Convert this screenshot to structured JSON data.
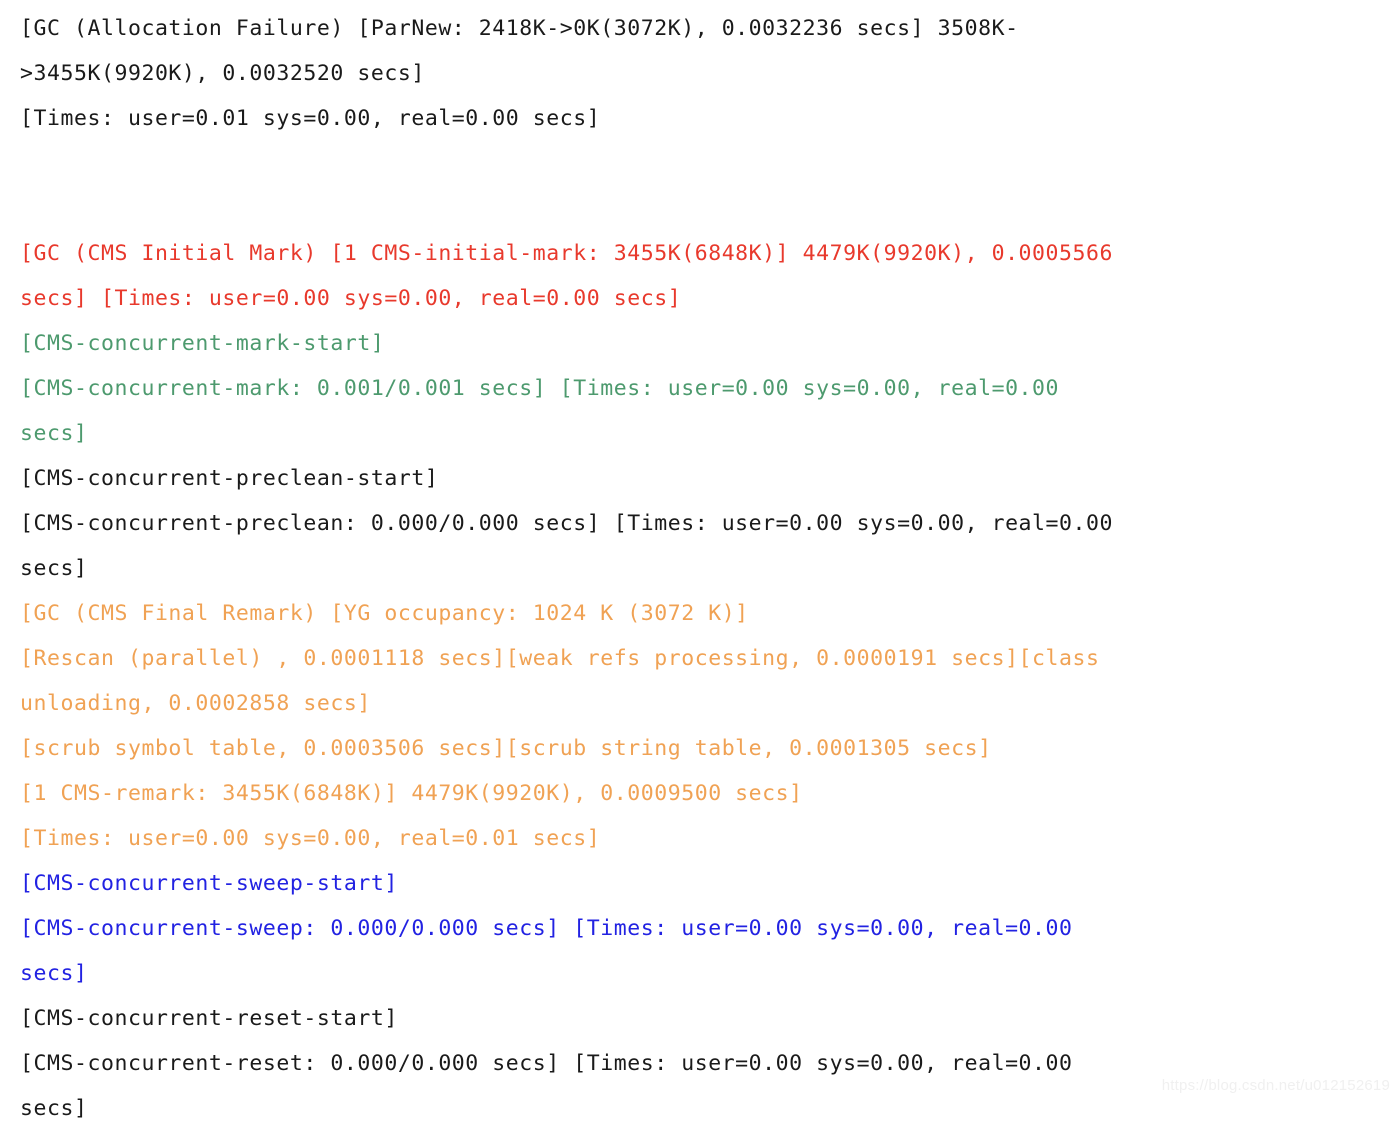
{
  "document": {
    "type": "gc-log-output",
    "background_color": "#ffffff",
    "colors": {
      "black": "#1a1a1a",
      "red": "#e8392c",
      "green": "#4d9a6e",
      "orange": "#f0a254",
      "blue": "#2222e2",
      "watermark": "#f0f0f0"
    },
    "watermark": "https://blog.csdn.net/u012152619",
    "lines": [
      {
        "color": "black",
        "text": "[GC (Allocation Failure) [ParNew: 2418K->0K(3072K), 0.0032236 secs] 3508K-"
      },
      {
        "color": "black",
        "text": ">3455K(9920K), 0.0032520 secs]"
      },
      {
        "color": "black",
        "text": "[Times: user=0.01 sys=0.00, real=0.00 secs]"
      },
      {
        "color": "black",
        "text": ""
      },
      {
        "color": "black",
        "text": ""
      },
      {
        "color": "red",
        "text": "[GC (CMS Initial Mark) [1 CMS-initial-mark: 3455K(6848K)] 4479K(9920K), 0.0005566"
      },
      {
        "color": "red",
        "text": "secs] [Times: user=0.00 sys=0.00, real=0.00 secs]"
      },
      {
        "color": "green",
        "text": "[CMS-concurrent-mark-start]"
      },
      {
        "color": "green",
        "text": "[CMS-concurrent-mark: 0.001/0.001 secs] [Times: user=0.00 sys=0.00, real=0.00"
      },
      {
        "color": "green",
        "text": "secs]"
      },
      {
        "color": "black",
        "text": "[CMS-concurrent-preclean-start]"
      },
      {
        "color": "black",
        "text": "[CMS-concurrent-preclean: 0.000/0.000 secs] [Times: user=0.00 sys=0.00, real=0.00"
      },
      {
        "color": "black",
        "text": "secs]"
      },
      {
        "color": "orange",
        "text": "[GC (CMS Final Remark) [YG occupancy: 1024 K (3072 K)]"
      },
      {
        "color": "orange",
        "text": "[Rescan (parallel) , 0.0001118 secs][weak refs processing, 0.0000191 secs][class"
      },
      {
        "color": "orange",
        "text": "unloading, 0.0002858 secs]"
      },
      {
        "color": "orange",
        "text": "[scrub symbol table, 0.0003506 secs][scrub string table, 0.0001305 secs]"
      },
      {
        "color": "orange",
        "text": "[1 CMS-remark: 3455K(6848K)] 4479K(9920K), 0.0009500 secs]"
      },
      {
        "color": "orange",
        "text": "[Times: user=0.00 sys=0.00, real=0.01 secs]"
      },
      {
        "color": "blue",
        "text": "[CMS-concurrent-sweep-start]"
      },
      {
        "color": "blue",
        "text": "[CMS-concurrent-sweep: 0.000/0.000 secs] [Times: user=0.00 sys=0.00, real=0.00"
      },
      {
        "color": "blue",
        "text": "secs]"
      },
      {
        "color": "black",
        "text": "[CMS-concurrent-reset-start]"
      },
      {
        "color": "black",
        "text": "[CMS-concurrent-reset: 0.000/0.000 secs] [Times: user=0.00 sys=0.00, real=0.00"
      },
      {
        "color": "black",
        "text": "secs]"
      }
    ]
  }
}
